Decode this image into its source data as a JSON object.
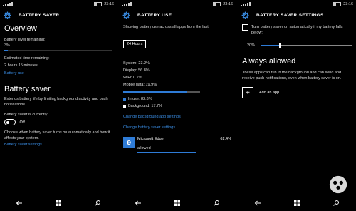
{
  "status": {
    "time": "23:16"
  },
  "panel1": {
    "title": "BATTERY SAVER",
    "overview": "Overview",
    "level_label": "Battery level remaining:",
    "level_value": "3%",
    "level_fraction": 0.03,
    "time_label": "Estimated time remaining:",
    "time_value": "2 hours 15 minutes",
    "battery_use_link": "Battery use",
    "saver_heading": "Battery saver",
    "saver_desc": "Extends battery life by limiting background activity and push notifications.",
    "saver_current_label": "Battery saver is currently:",
    "toggle_state": "Off",
    "choose_text": "Choose when battery saver turns on automatically and how it affects your system.",
    "settings_link": "Battery saver settings"
  },
  "panel2": {
    "title": "BATTERY USE",
    "showing": "Showing battery use across all apps from the last:",
    "range": "24 Hours",
    "system": "System: 23.2%",
    "display": "Display: 56.8%",
    "wifi": "WiFi: 0.2%",
    "mobile": "Mobile data: 19.9%",
    "in_use": "In use: 82.3%",
    "background": "Background: 17.7%",
    "in_use_fraction": 0.823,
    "change_bg_link": "Change background app settings",
    "change_saver_link": "Change battery saver settings",
    "app_name": "Microsoft Edge",
    "app_percent": "62.4%",
    "app_status": "allowed",
    "app_fraction": 0.624
  },
  "panel3": {
    "title": "BATTERY SAVER SETTINGS",
    "auto_label": "Turn battery saver on automatically if my battery falls below:",
    "slider_value": "20%",
    "slider_fraction": 0.2,
    "always_allowed": "Always allowed",
    "allowed_desc": "These apps can run in the background and can send and receive push notifications, even when battery saver is on.",
    "add_app": "Add an app"
  },
  "colors": {
    "accent": "#2e7bd6",
    "link": "#3a8ee6",
    "background": "#000000"
  },
  "icons": [
    "settings-gear-icon",
    "back-arrow-icon",
    "windows-start-icon",
    "search-icon",
    "microsoft-edge-icon",
    "plus-icon"
  ]
}
